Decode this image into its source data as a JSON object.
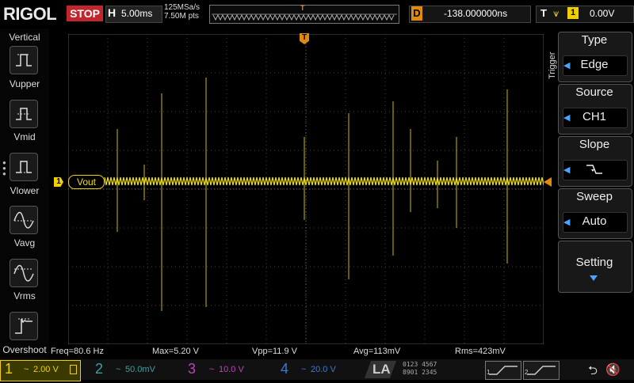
{
  "header": {
    "brand": "RIGOL",
    "run_state": "STOP",
    "timebase_label": "H",
    "timebase_value": "5.00ms",
    "sample_rate": "125MSa/s",
    "memory_depth": "7.50M pts",
    "trigger_marker": "T",
    "delay_label": "D",
    "delay_value": "-138.000000ns",
    "trigger_label": "T",
    "trigger_channel": "1",
    "trigger_level": "0.00V"
  },
  "left_menu": {
    "title": "Vertical",
    "items": [
      {
        "label": "Vupper",
        "icon": "vupper-icon"
      },
      {
        "label": "Vmid",
        "icon": "vmid-icon"
      },
      {
        "label": "Vlower",
        "icon": "vlower-icon"
      },
      {
        "label": "Vavg",
        "icon": "vavg-icon"
      },
      {
        "label": "Vrms",
        "icon": "vrms-icon"
      },
      {
        "label": "Overshoot",
        "icon": "overshoot-icon"
      }
    ]
  },
  "display": {
    "channel_marker": "1",
    "trace_label": "Vout",
    "trace_color": "#f0e000",
    "trigger_marker": "T"
  },
  "trigger_menu": {
    "title": "Trigger",
    "type_title": "Type",
    "type_value": "Edge",
    "source_title": "Source",
    "source_value": "CH1",
    "slope_title": "Slope",
    "slope_icon": "falling-edge-icon",
    "sweep_title": "Sweep",
    "sweep_value": "Auto",
    "setting_label": "Setting"
  },
  "measurements": {
    "freq": "Freq=80.6 Hz",
    "max": "Max=5.20 V",
    "vpp": "Vpp=11.9 V",
    "avg": "Avg=113mV",
    "rms": "Rms=423mV"
  },
  "channels": [
    {
      "num": "1",
      "coupling": "~",
      "scale": "2.00 V",
      "color": "#f0d000"
    },
    {
      "num": "2",
      "coupling": "~",
      "scale": "50.0mV",
      "color": "#3aa0a0"
    },
    {
      "num": "3",
      "coupling": "~",
      "scale": "10.0 V",
      "color": "#c040c0"
    },
    {
      "num": "4",
      "coupling": "~",
      "scale": "20.0 V",
      "color": "#3a7ad0"
    }
  ],
  "la": {
    "label": "LA",
    "digits_top": "0123 4567",
    "digits_bottom": "8901 2345"
  },
  "bus_labels": [
    "1",
    "2"
  ],
  "colors": {
    "accent": "#f0d000",
    "stop": "#c0262b",
    "menu_arrow": "#4aa3ff",
    "delay": "#e08a10"
  }
}
